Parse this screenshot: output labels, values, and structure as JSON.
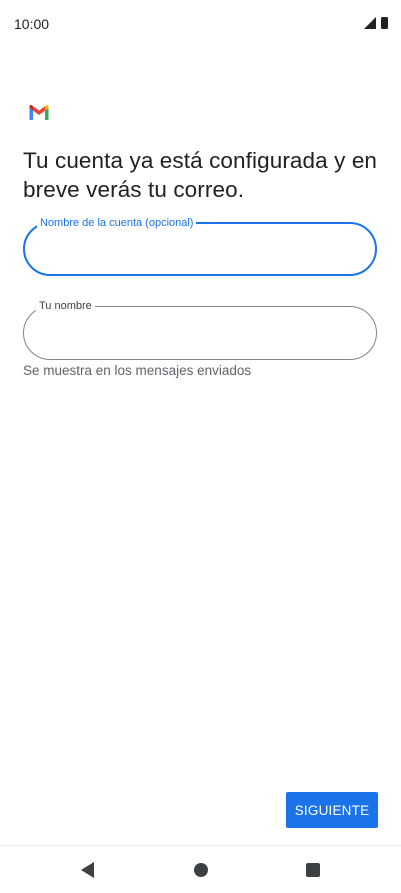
{
  "status_bar": {
    "time": "10:00",
    "signal_icon": "signal-icon",
    "battery_icon": "battery-icon"
  },
  "logo": {
    "icon": "gmail-logo-icon",
    "colors": {
      "red": "#ea4335",
      "blue": "#4285f4",
      "green": "#34a853",
      "yellow": "#fbbc04",
      "dark_red": "#c5221f"
    }
  },
  "headline": "Tu cuenta ya está configurada y en breve verás tu correo.",
  "account_name_field": {
    "label": "Nombre de la cuenta (opcional)",
    "value": ""
  },
  "your_name_field": {
    "label": "Tu nombre",
    "value": "",
    "helper": "Se muestra en los mensajes enviados"
  },
  "next_button": {
    "label": "SIGUIENTE"
  },
  "navigation": {
    "back": "back-icon",
    "home": "home-icon",
    "recents": "recents-icon"
  },
  "colors": {
    "accent": "#1a73e8",
    "text": "#202124",
    "secondary_text": "#5f6368"
  }
}
